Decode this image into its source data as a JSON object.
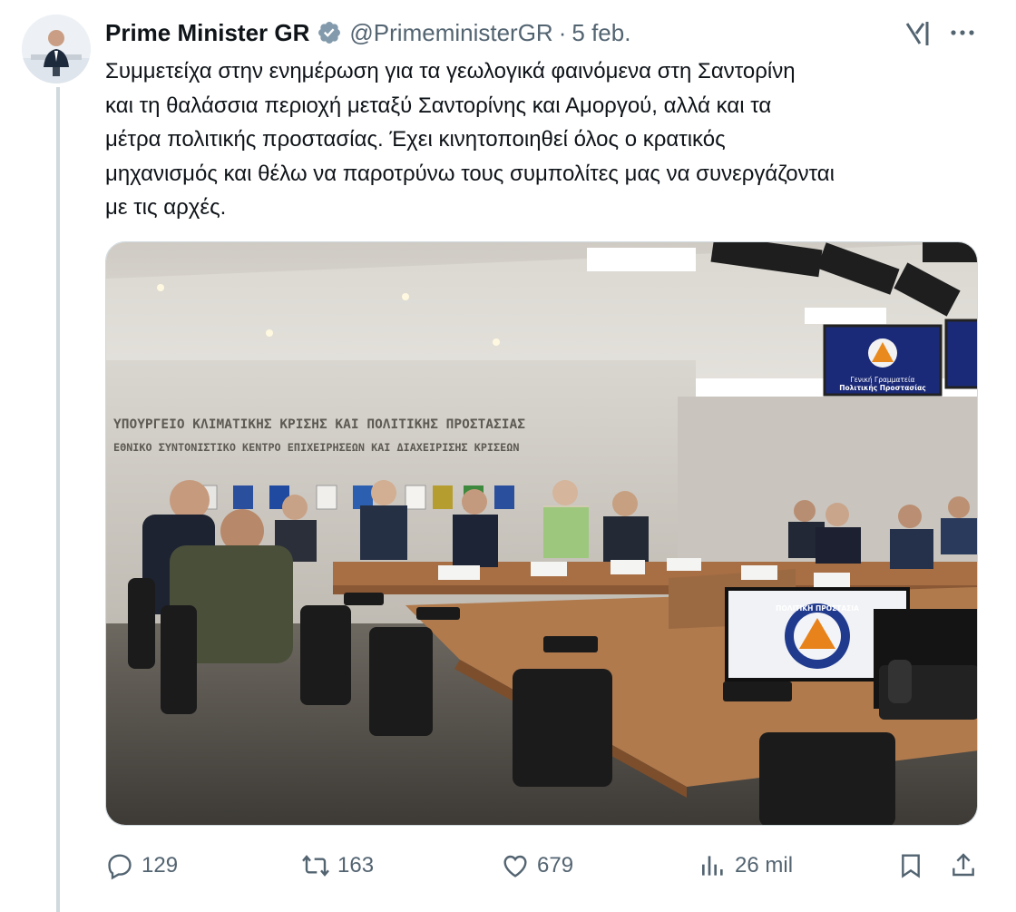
{
  "author": {
    "display_name": "Prime Minister GR",
    "handle": "@PrimeministerGR",
    "separator": "·",
    "date": "5 feb.",
    "verified": true,
    "avatar_icon": "profile-photo-avatar"
  },
  "tweet": {
    "text": "Συμμετείχα στην ενημέρωση για τα γεωλογικά φαινόμενα στη Σαντορίνη\nκαι τη θαλάσσια περιοχή μεταξύ Σαντορίνης και Αμοργού, αλλά και τα\nμέτρα πολιτικής προστασίας. Έχει κινητοποιηθεί όλος ο κρατικός\nμηχανισμός και θέλω να παροτρύνω τους συμπολίτες μας να συνεργάζονται\nμε τις αρχές."
  },
  "image": {
    "wall_line_1": "ΥΠΟΥΡΓΕΙΟ ΚΛΙΜΑΤΙΚΗΣ ΚΡΙΣΗΣ ΚΑΙ ΠΟΛΙΤΙΚΗΣ ΠΡΟΣΤΑΣΙΑΣ",
    "wall_line_2": "ΕΘΝΙΚΟ ΣΥΝΤΟΝΙΣΤΙΚΟ ΚΕΝΤΡΟ ΕΠΙΧΕΙΡΗΣΕΩΝ ΚΑΙ ΔΙΑΧΕΙΡΙΣΗΣ ΚΡΙΣΕΩΝ",
    "screen_line_1": "Γενική Γραμματεία",
    "screen_line_2": "Πολιτικής Προστασίας",
    "logo_text": "ΠΟΛΙΤΙΚΗ ΠΡΟΣΤΑΣΙΑ"
  },
  "actions": {
    "replies": "129",
    "reposts": "163",
    "likes": "679",
    "views": "26 mil"
  },
  "colors": {
    "text": "#0f1419",
    "secondary": "#536471",
    "verified_badge": "#829aab",
    "thread_line": "#cfd9de"
  }
}
